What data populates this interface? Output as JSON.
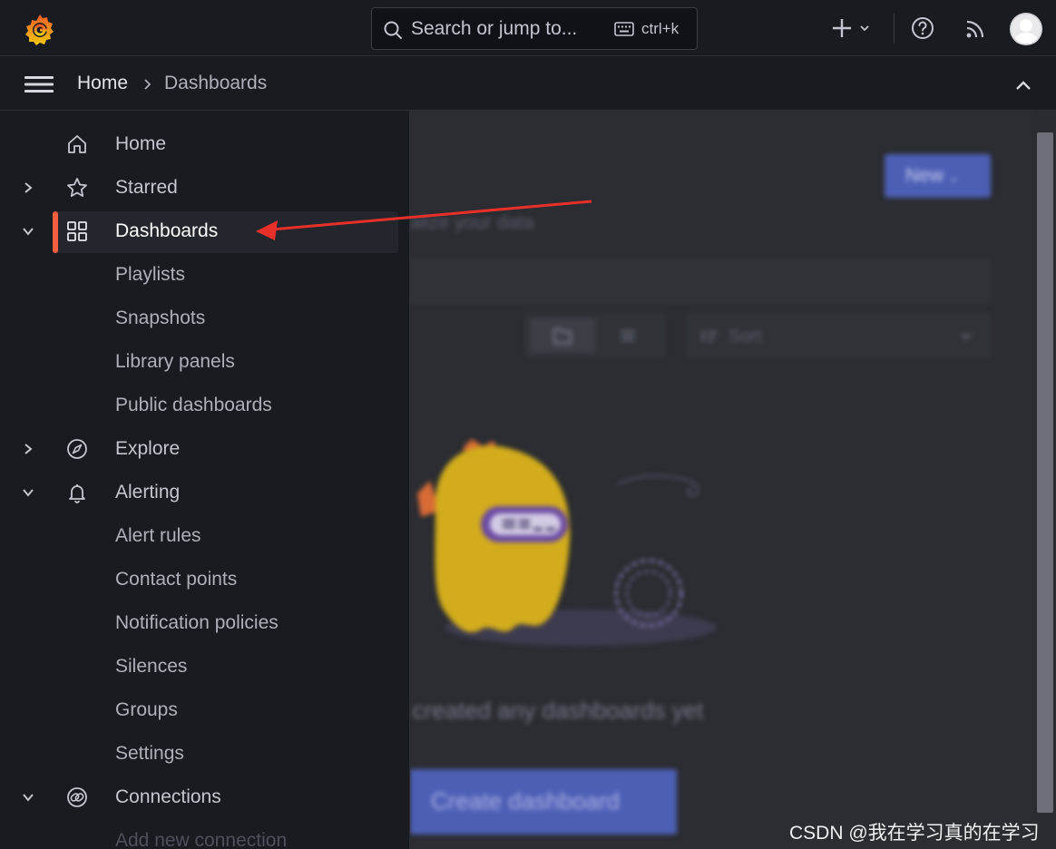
{
  "topbar": {
    "search_placeholder": "Search or jump to...",
    "search_shortcut": "ctrl+k"
  },
  "breadcrumb": {
    "home": "Home",
    "current": "Dashboards"
  },
  "main": {
    "new_button": "New",
    "subtitle_fragment": "alize your data",
    "sort_label": "Sort",
    "empty_message_fragment": "t created any dashboards yet",
    "create_button": "Create dashboard"
  },
  "sidebar": {
    "items": [
      {
        "label": "Home",
        "icon": "home-icon",
        "chevron": ""
      },
      {
        "label": "Starred",
        "icon": "star-icon",
        "chevron": "right"
      },
      {
        "label": "Dashboards",
        "icon": "apps-icon",
        "chevron": "down",
        "active": true
      },
      {
        "label": "Playlists"
      },
      {
        "label": "Snapshots"
      },
      {
        "label": "Library panels"
      },
      {
        "label": "Public dashboards"
      },
      {
        "label": "Explore",
        "icon": "compass-icon",
        "chevron": "right"
      },
      {
        "label": "Alerting",
        "icon": "bell-icon",
        "chevron": "down"
      },
      {
        "label": "Alert rules"
      },
      {
        "label": "Contact points"
      },
      {
        "label": "Notification policies"
      },
      {
        "label": "Silences"
      },
      {
        "label": "Groups"
      },
      {
        "label": "Settings"
      },
      {
        "label": "Connections",
        "icon": "link-icon",
        "chevron": "down"
      },
      {
        "label": "Add new connection"
      }
    ]
  },
  "colors": {
    "accent": "#f55f3e",
    "primary": "#4d5fb5",
    "annotation_arrow": "#e8302a"
  },
  "watermark": "CSDN @我在学习真的在学习"
}
